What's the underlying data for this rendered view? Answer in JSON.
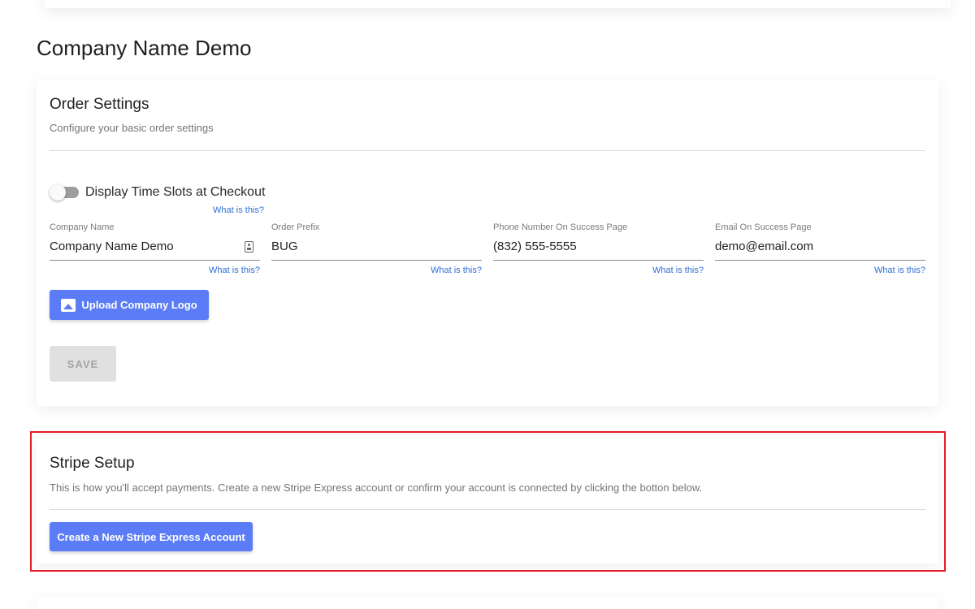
{
  "page": {
    "title": "Company Name Demo"
  },
  "order_settings": {
    "title": "Order Settings",
    "subtitle": "Configure your basic order settings",
    "toggle": {
      "label": "Display Time Slots at Checkout",
      "checked": false,
      "help": "What is this?"
    },
    "fields": [
      {
        "label": "Company Name",
        "value": "Company Name Demo",
        "help": "What is this?",
        "icon": "contact-card-icon"
      },
      {
        "label": "Order Prefix",
        "value": "BUG",
        "help": "What is this?"
      },
      {
        "label": "Phone Number On Success Page",
        "value": "(832) 555-5555",
        "help": "What is this?"
      },
      {
        "label": "Email On Success Page",
        "value": "demo@email.com",
        "help": "What is this?"
      }
    ],
    "upload_button": {
      "label": "Upload Company Logo",
      "icon": "image-icon"
    },
    "save_button": {
      "label": "SAVE",
      "disabled": true
    }
  },
  "stripe_setup": {
    "title": "Stripe Setup",
    "subtitle": "This is how you'll accept payments. Create a new Stripe Express account or confirm your account is connected by clicking the botton below.",
    "button": {
      "label": "Create a New Stripe Express Account"
    }
  },
  "colors": {
    "primary": "#5b7cf6",
    "link": "#2f6fd6",
    "highlight": "#e01e2a",
    "disabled_bg": "#e0e0e0"
  }
}
